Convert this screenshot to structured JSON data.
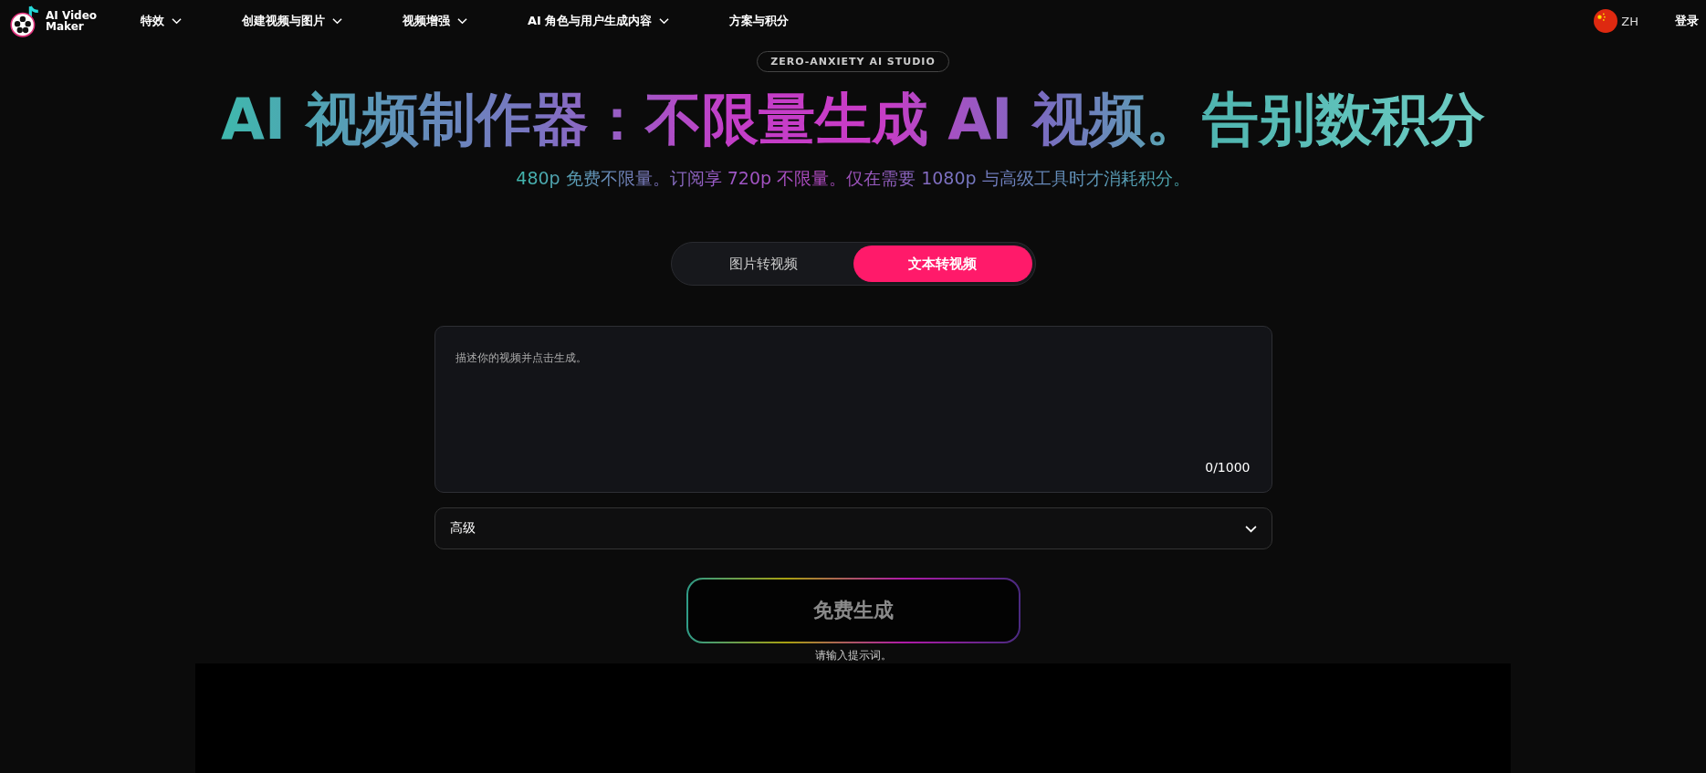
{
  "logo": {
    "line1": "AI Video",
    "line2": "Maker"
  },
  "nav": [
    {
      "label": "特效"
    },
    {
      "label": "创建视频与图片"
    },
    {
      "label": "视频增强"
    },
    {
      "label": "AI 角色与用户生成内容"
    },
    {
      "label": "方案与积分",
      "dropdown": false
    }
  ],
  "language": {
    "code": "ZH"
  },
  "login": "登录",
  "badge": "ZERO-ANXIETY AI STUDIO",
  "headline": "AI 视频制作器：不限量生成 AI 视频。告别数积分",
  "subtitle": "480p 免费不限量。订阅享 720p 不限量。仅在需要 1080p 与高级工具时才消耗积分。",
  "tabs": [
    {
      "label": "图片转视频",
      "selected": false
    },
    {
      "label": "文本转视频",
      "selected": true
    }
  ],
  "prompt": {
    "placeholder": "描述你的视频并点击生成。",
    "counter": "0/1000"
  },
  "advanced": {
    "label": "高级",
    "expanded": false
  },
  "generate": {
    "label": "免费生成",
    "disabled": true
  },
  "hint": "请输入提示词。",
  "preview": {
    "kind": "video-area"
  }
}
